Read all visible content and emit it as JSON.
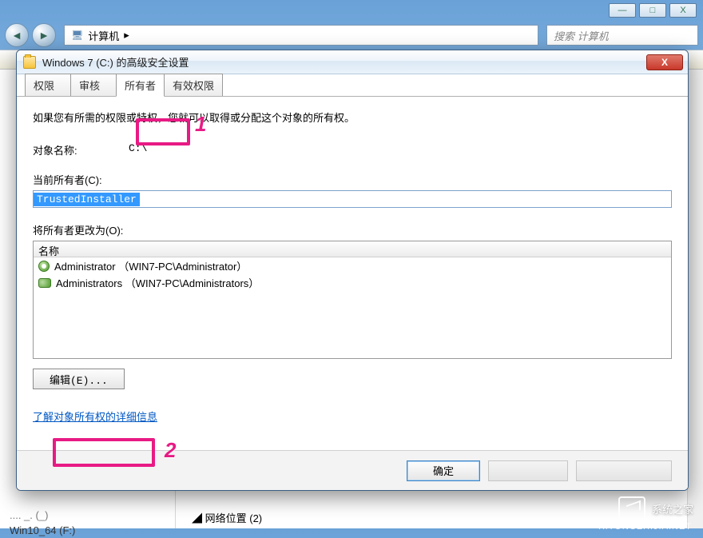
{
  "parent_window": {
    "min_glyph": "—",
    "max_glyph": "□",
    "close_glyph": "X",
    "nav_back_glyph": "◄",
    "nav_fwd_glyph": "►",
    "address_icon": "🖥",
    "address_text": "计算机",
    "search_placeholder": "搜索 计算机",
    "tree_item_1": ".... _. (_)",
    "tree_item_2": "Win10_64 (F:)",
    "tree_item_footer": "网络位置 (2)"
  },
  "dialog": {
    "title": "Windows 7 (C:) 的高级安全设置",
    "close_glyph": "X",
    "tabs": {
      "perm": "权限",
      "audit": "审核",
      "owner": "所有者",
      "effective": "有效权限"
    },
    "intro": "如果您有所需的权限或特权，您就可以取得或分配这个对象的所有权。",
    "object_name_label": "对象名称:",
    "object_name_value": "C:\\",
    "current_owner_label": "当前所有者(C):",
    "current_owner_value": "TrustedInstaller",
    "change_owner_label": "将所有者更改为(O):",
    "list_header": "名称",
    "owners": [
      "Administrator （WIN7-PC\\Administrator）",
      "Administrators （WIN7-PC\\Administrators）"
    ],
    "edit_btn": "编辑(E)...",
    "learn_link": "了解对象所有权的详细信息",
    "ok_btn": "确定",
    "cancel_btn": "",
    "apply_btn": ""
  },
  "annotations": {
    "num1": "1",
    "num2": "2"
  },
  "watermark": {
    "brand": "系统之家",
    "url": "XITONGZHIJIA.NET"
  }
}
